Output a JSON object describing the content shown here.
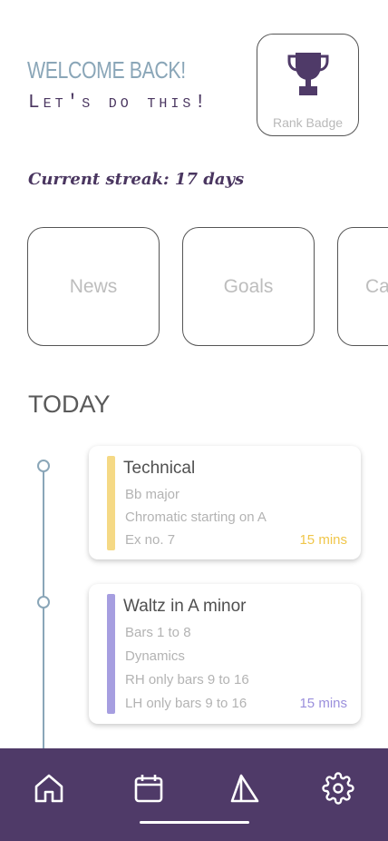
{
  "header": {
    "welcome": "WELCOME BACK!",
    "tagline": "Let's do this!",
    "rank_badge_label": "Rank Badge",
    "rank_badge_icon": "trophy-icon"
  },
  "streak": {
    "text": "Current streak: 17 days"
  },
  "cards": [
    "News",
    "Goals",
    "Ca"
  ],
  "today": {
    "heading": "TODAY",
    "tasks": [
      {
        "title": "Technical",
        "items": [
          "Bb major",
          "Chromatic starting on A",
          "Ex no. 7"
        ],
        "duration": "15 mins",
        "color": "#f5d985",
        "duration_color": "#f0c64a"
      },
      {
        "title": "Waltz in A minor",
        "items": [
          "Bars 1 to 8",
          "Dynamics",
          "RH only bars 9 to 16",
          "LH only bars 9 to 16"
        ],
        "duration": "15 mins",
        "color": "#a69ee0",
        "duration_color": "#9a8fdc"
      }
    ]
  },
  "nav": {
    "items": [
      "home-icon",
      "calendar-icon",
      "triangle-icon",
      "gear-icon"
    ],
    "active_index": 1,
    "background": "#4f3a68"
  },
  "colors": {
    "accent": "#4a3660",
    "muted_blue": "#8aa6b8"
  }
}
